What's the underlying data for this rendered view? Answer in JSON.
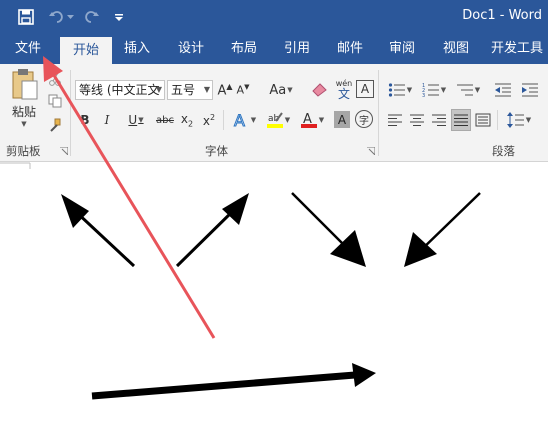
{
  "window": {
    "title": "Doc1  -  Word"
  },
  "tabs": [
    "文件",
    "开始",
    "插入",
    "设计",
    "布局",
    "引用",
    "邮件",
    "审阅",
    "视图",
    "开发工具"
  ],
  "clipboard": {
    "paste_label": "粘贴",
    "group_label": "剪贴板"
  },
  "font": {
    "font_name": "等线 (中文正文",
    "font_size": "五号",
    "group_label": "字体",
    "phonetic_top": "wén",
    "phonetic_bottom": "文",
    "border_char": "A",
    "enclose_char": "字"
  },
  "paragraph": {
    "group_label": "段落"
  },
  "colors": {
    "brand": "#2b579a",
    "ribbon": "#f3f3f3",
    "highlight": "#ffff00",
    "font_color": "#e02020",
    "annotation_arrow": "#e8545a"
  }
}
